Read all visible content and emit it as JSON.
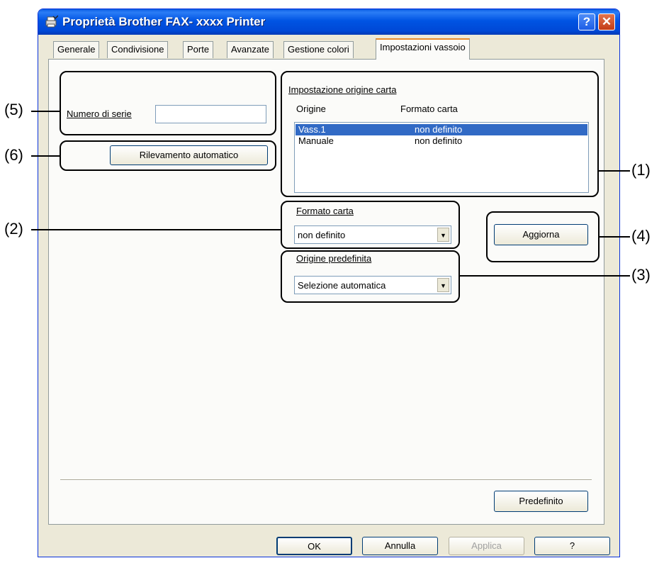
{
  "window": {
    "title": "Proprietà Brother FAX- xxxx Printer",
    "help_label": "?",
    "close_label": "✕"
  },
  "tabs": [
    {
      "label": "Generale"
    },
    {
      "label": "Condivisione"
    },
    {
      "label": "Porte"
    },
    {
      "label": "Avanzate"
    },
    {
      "label": "Gestione colori"
    },
    {
      "label": "Impostazioni vassoio",
      "active": true
    }
  ],
  "serial": {
    "label": "Numero di serie",
    "value": ""
  },
  "auto_detect_button": "Rilevamento automatico",
  "paper_source": {
    "group_label": "Impostazione origine carta",
    "col_source": "Origine",
    "col_size": "Formato carta",
    "rows": [
      {
        "source": "Vass.1",
        "size": "non definito",
        "selected": true
      },
      {
        "source": "Manuale",
        "size": "non definito",
        "selected": false
      }
    ]
  },
  "paper_size": {
    "label": "Formato carta",
    "value": "non definito"
  },
  "update_button": "Aggiorna",
  "default_source": {
    "label": "Origine predefinita",
    "value": "Selezione automatica"
  },
  "default_button": "Predefinito",
  "footer": {
    "ok": "OK",
    "cancel": "Annulla",
    "apply": "Applica",
    "help": "?"
  },
  "callouts": {
    "c1": "(1)",
    "c2": "(2)",
    "c3": "(3)",
    "c4": "(4)",
    "c5": "(5)",
    "c6": "(6)"
  },
  "colors": {
    "titlebar": "#0054e3",
    "selection": "#316ac5",
    "dialog_bg": "#ece9d8"
  }
}
